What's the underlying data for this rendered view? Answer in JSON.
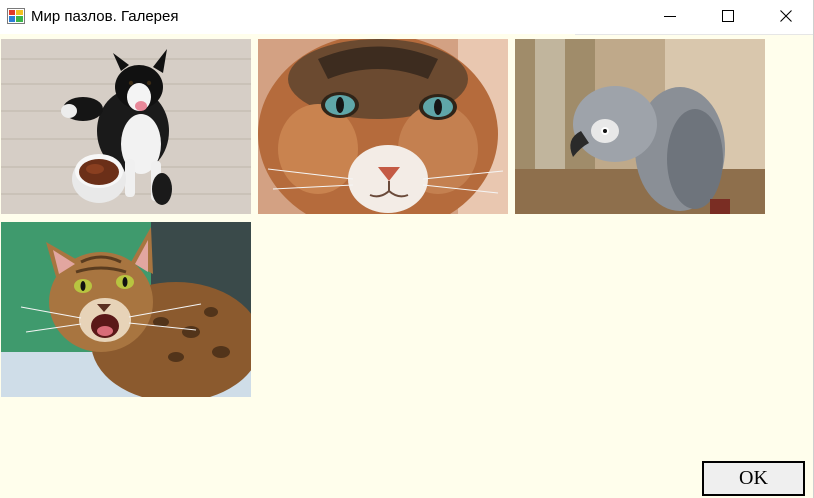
{
  "window": {
    "title": "Мир пазлов. Галерея",
    "icon": "app-window-icon"
  },
  "controls": {
    "minimize_icon": "minimize-icon",
    "maximize_icon": "maximize-icon",
    "close_icon": "close-icon"
  },
  "gallery": {
    "background": "#fffeec",
    "images": [
      {
        "subject": "dog-with-food-bowl"
      },
      {
        "subject": "cat-face-closeup"
      },
      {
        "subject": "grey-parrot"
      },
      {
        "subject": "bengal-cat"
      }
    ]
  },
  "footer": {
    "ok_label": "OK"
  }
}
